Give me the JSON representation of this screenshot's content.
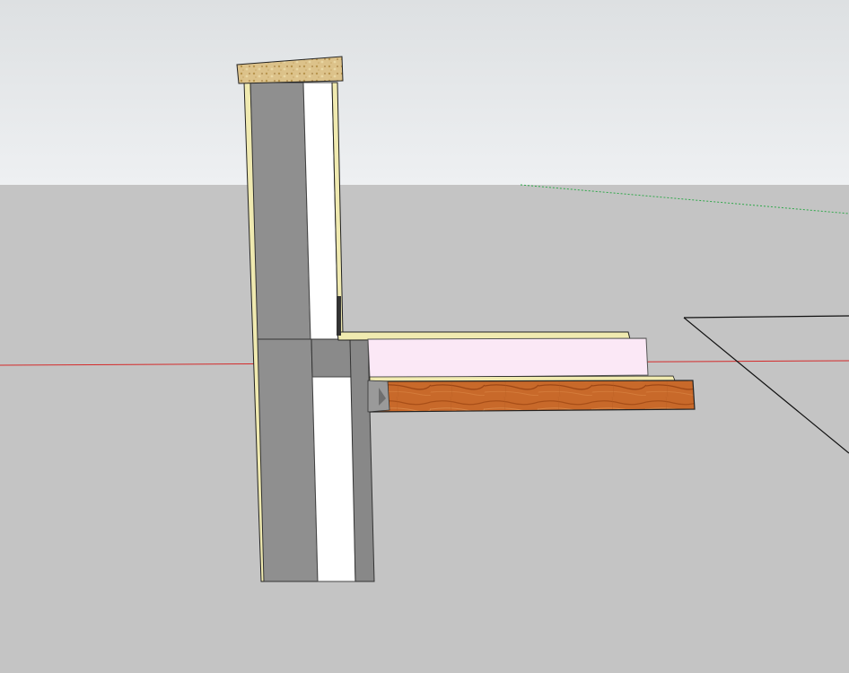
{
  "viewport": {
    "sky_top": "#dde0e2",
    "sky_bottom": "#eef0f2",
    "ground": "#c4c4c4"
  },
  "axes": {
    "red": "#d42a2a",
    "green": "#2fa84a",
    "black": "#111111"
  },
  "materials": {
    "concrete": "#8f8f8f",
    "concrete_edge": "#7a7a7a",
    "insulation_white": "#ffffff",
    "membrane": "#f0eab0",
    "osb": "#dcc28a",
    "floor_insulation": "#fbe8f6",
    "wood_floor": "#c8692a",
    "outline": "#222222"
  }
}
